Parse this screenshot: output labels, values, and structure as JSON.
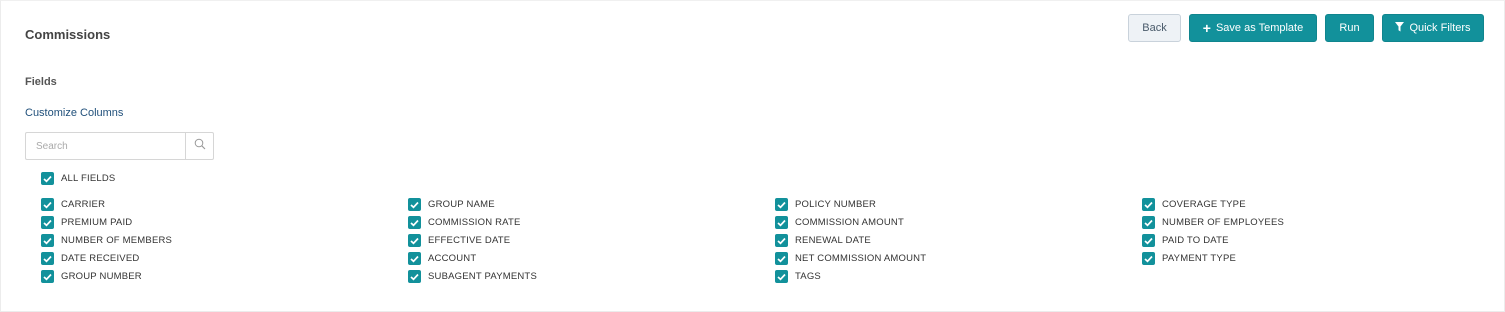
{
  "header": {
    "title": "Commissions"
  },
  "toolbar": {
    "back_label": "Back",
    "save_label": "Save as Template",
    "run_label": "Run",
    "filters_label": "Quick Filters"
  },
  "fields": {
    "section_label": "Fields",
    "customize_link": "Customize Columns",
    "search_placeholder": "Search",
    "all_fields_label": "ALL FIELDS",
    "all_fields_checked": true,
    "columns": [
      [
        {
          "label": "CARRIER",
          "checked": true
        },
        {
          "label": "PREMIUM PAID",
          "checked": true
        },
        {
          "label": "NUMBER OF MEMBERS",
          "checked": true
        },
        {
          "label": "DATE RECEIVED",
          "checked": true
        },
        {
          "label": "GROUP NUMBER",
          "checked": true
        }
      ],
      [
        {
          "label": "GROUP NAME",
          "checked": true
        },
        {
          "label": "COMMISSION RATE",
          "checked": true
        },
        {
          "label": "EFFECTIVE DATE",
          "checked": true
        },
        {
          "label": "ACCOUNT",
          "checked": true
        },
        {
          "label": "SUBAGENT PAYMENTS",
          "checked": true
        }
      ],
      [
        {
          "label": "POLICY NUMBER",
          "checked": true
        },
        {
          "label": "COMMISSION AMOUNT",
          "checked": true
        },
        {
          "label": "RENEWAL DATE",
          "checked": true
        },
        {
          "label": "NET COMMISSION AMOUNT",
          "checked": true
        },
        {
          "label": "TAGS",
          "checked": true
        }
      ],
      [
        {
          "label": "COVERAGE TYPE",
          "checked": true
        },
        {
          "label": "NUMBER OF EMPLOYEES",
          "checked": true
        },
        {
          "label": "PAID TO DATE",
          "checked": true
        },
        {
          "label": "PAYMENT TYPE",
          "checked": true
        }
      ]
    ]
  },
  "colors": {
    "primary": "#12919b",
    "link": "#1f4f7a"
  },
  "icons": {
    "save": "plus-icon",
    "filters": "filter-icon",
    "search": "search-icon",
    "checkbox": "checkmark-icon"
  }
}
